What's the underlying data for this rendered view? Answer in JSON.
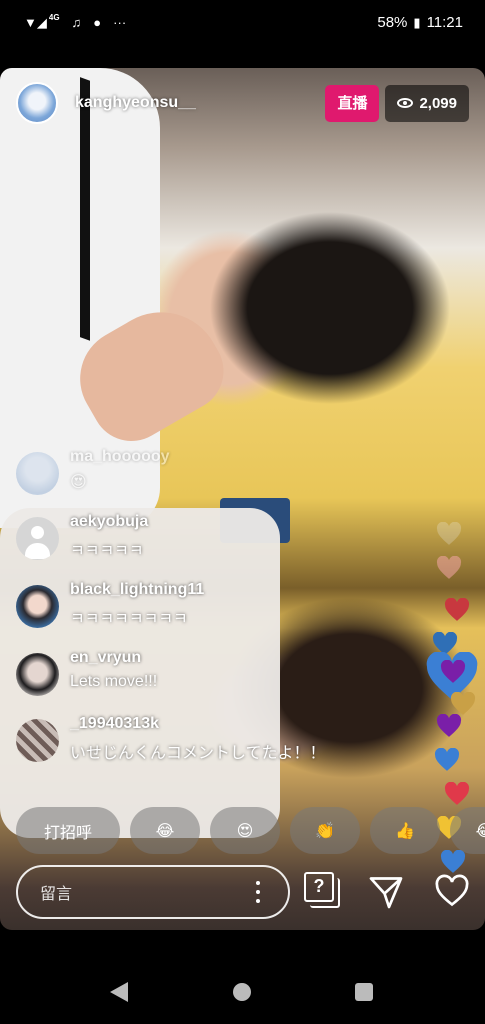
{
  "status_bar": {
    "network": "4G",
    "battery": "58%",
    "time": "11:21",
    "more": "···"
  },
  "live": {
    "username": "kanghyeonsu__",
    "live_label": "直播",
    "viewer_count": "2,099"
  },
  "comments": [
    {
      "name": "ma_hoooooy",
      "text": "😍",
      "faded": true
    },
    {
      "name": "aekyobuja",
      "text": "ㅋㅋㅋㅋㅋ"
    },
    {
      "name": "black_lightning11",
      "text": "ㅋㅋㅋㅋㅋㅋㅋㅋ"
    },
    {
      "name": "en_vryun",
      "text": "Lets move!!!"
    },
    {
      "name": "_19940313k",
      "text": "いせじんくんコメントしてたよ！！"
    }
  ],
  "reactions": [
    "打招呼",
    "😂",
    "😍",
    "👏",
    "👍",
    "😂"
  ],
  "input": {
    "placeholder": "留言"
  },
  "icons": {
    "qa": "question-box-icon",
    "send": "paper-plane-icon",
    "like": "heart-outline-icon"
  },
  "colors": {
    "live_badge": "#e0196e",
    "heart_blue": "#3b7fd4",
    "heart_red": "#e0394a",
    "heart_yellow": "#f0c233",
    "heart_purple": "#7a1fa8"
  }
}
